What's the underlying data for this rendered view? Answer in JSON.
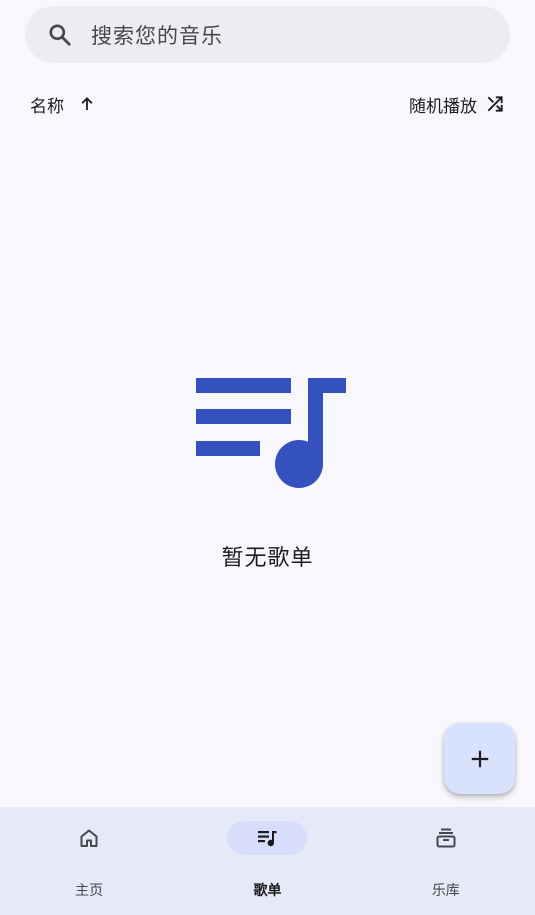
{
  "search": {
    "placeholder": "搜索您的音乐",
    "icon": "search-icon"
  },
  "sort": {
    "label": "名称",
    "direction_icon": "arrow-up-icon",
    "shuffle_label": "随机播放",
    "shuffle_icon": "shuffle-icon"
  },
  "empty_state": {
    "icon": "playlist-music-icon",
    "text": "暂无歌单"
  },
  "fab": {
    "icon": "add-icon"
  },
  "bottom_nav": {
    "items": [
      {
        "label": "主页",
        "icon": "home-icon",
        "active": false
      },
      {
        "label": "歌单",
        "icon": "playlist-icon",
        "active": true
      },
      {
        "label": "乐库",
        "icon": "library-icon",
        "active": false
      }
    ]
  },
  "colors": {
    "background": "#f8f7fc",
    "accent": "#3551be",
    "search_bg": "#ecedf2",
    "nav_bg": "#e6e9f7",
    "active_pill": "#d6defb",
    "fab_bg": "#d9e2fc"
  }
}
